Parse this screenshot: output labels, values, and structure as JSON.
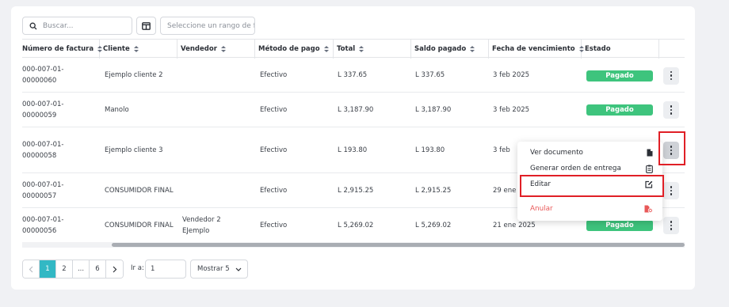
{
  "toolbar": {
    "search_placeholder": "Buscar...",
    "date_range_placeholder": "Seleccione un rango de fechas"
  },
  "table": {
    "columns": [
      "Número de factura",
      "Cliente",
      "Vendedor",
      "Método de pago",
      "Total",
      "Saldo pagado",
      "Fecha de vencimiento",
      "Estado"
    ],
    "rows": [
      {
        "invoice_line1": "000-007-01-",
        "invoice_line2": "00000060",
        "client": "Ejemplo cliente 2",
        "seller_line1": "",
        "seller_line2": "",
        "payment_method": "Efectivo",
        "total": "L 337.65",
        "paid": "L 337.65",
        "due_date": "3 feb 2025",
        "status": "Pagado"
      },
      {
        "invoice_line1": "000-007-01-",
        "invoice_line2": "00000059",
        "client": "Manolo",
        "seller_line1": "",
        "seller_line2": "",
        "payment_method": "Efectivo",
        "total": "L 3,187.90",
        "paid": "L 3,187.90",
        "due_date": "3 feb 2025",
        "status": "Pagado"
      },
      {
        "invoice_line1": "000-007-01-",
        "invoice_line2": "00000058",
        "client": "Ejemplo cliente 3",
        "seller_line1": "",
        "seller_line2": "",
        "payment_method": "Efectivo",
        "total": "L 193.80",
        "paid": "L 193.80",
        "due_date": "3 feb",
        "status": ""
      },
      {
        "invoice_line1": "000-007-01-",
        "invoice_line2": "00000057",
        "client": "CONSUMIDOR FINAL",
        "seller_line1": "",
        "seller_line2": "",
        "payment_method": "Efectivo",
        "total": "L 2,915.25",
        "paid": "L 2,915.25",
        "due_date": "29 ene",
        "status": ""
      },
      {
        "invoice_line1": "000-007-01-",
        "invoice_line2": "00000056",
        "client": "CONSUMIDOR FINAL",
        "seller_line1": "Vendedor 2",
        "seller_line2": "EJemplo",
        "payment_method": "Efectivo",
        "total": "L 5,269.02",
        "paid": "L 5,269.02",
        "due_date": "21 ene 2025",
        "status": "Pagado"
      }
    ]
  },
  "context_menu": {
    "items": [
      "Ver documento",
      "Generar orden de entrega",
      "Editar",
      "Anular"
    ]
  },
  "pagination": {
    "pages": [
      "1",
      "2",
      "...",
      "6"
    ],
    "goto_label": "Ir a:",
    "goto_value": "1",
    "page_size_label": "Mostrar 5"
  },
  "colors": {
    "status_paid": "#3ec47d",
    "active_page": "#32b8c4",
    "danger": "#e85858",
    "highlight": "#e01f26"
  }
}
